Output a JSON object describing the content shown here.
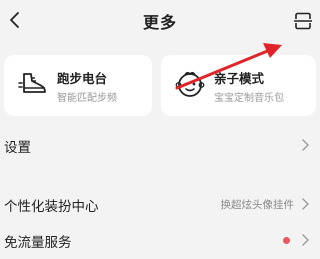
{
  "header": {
    "title": "更多",
    "back_icon": "chevron-left-icon",
    "scan_icon": "scan-icon"
  },
  "cards": [
    {
      "title": "跑步电台",
      "subtitle": "智能匹配步频",
      "icon": "running-shoe-icon"
    },
    {
      "title": "亲子模式",
      "subtitle": "宝宝定制音乐包",
      "icon": "baby-face-icon"
    }
  ],
  "rows": {
    "settings": {
      "label": "设置"
    },
    "personalize": {
      "label": "个性化装扮中心",
      "hint": "换超炫头像挂件"
    },
    "free_traffic": {
      "label": "免流量服务"
    }
  },
  "colors": {
    "background": "#f3f3f3",
    "card": "#ffffff",
    "annotation_arrow": "#e0242a",
    "badge_dot": "#e8585c"
  }
}
